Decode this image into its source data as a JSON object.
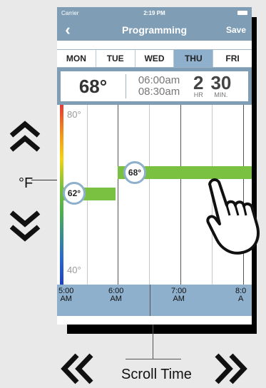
{
  "status": {
    "carrier": "Carrier",
    "time": "2:19 PM"
  },
  "nav": {
    "back": "‹",
    "title": "Programming",
    "save": "Save"
  },
  "days": [
    {
      "label": "MON",
      "active": false
    },
    {
      "label": "TUE",
      "active": false
    },
    {
      "label": "WED",
      "active": false
    },
    {
      "label": "THU",
      "active": true
    },
    {
      "label": "FRI",
      "active": false
    }
  ],
  "info": {
    "temp": "68°",
    "start_time": "06:00am",
    "end_time": "08:30am",
    "hours": "2",
    "hours_label": "HR",
    "minutes": "30",
    "minutes_label": "MIN."
  },
  "chart": {
    "y_top": "80°",
    "y_bottom": "40°",
    "setpoints": [
      {
        "temp": "62°",
        "value": 62
      },
      {
        "temp": "68°",
        "value": 68
      }
    ]
  },
  "time_axis": [
    {
      "time": "5:00",
      "ampm": "AM"
    },
    {
      "time": "6:00",
      "ampm": "AM"
    },
    {
      "time": "7:00",
      "ampm": "AM"
    },
    {
      "time": "8:0",
      "ampm": "A"
    }
  ],
  "annotations": {
    "unit": "°F",
    "scroll": "Scroll Time"
  },
  "colors": {
    "header": "#7f9eb5",
    "active_day": "#8eb0cc",
    "bar": "#7ac142"
  }
}
